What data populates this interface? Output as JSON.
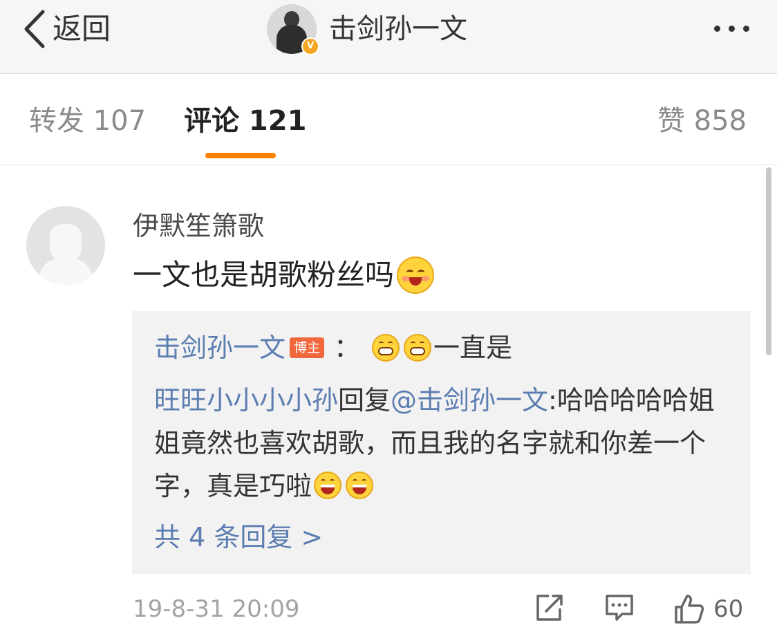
{
  "nav": {
    "back_label": "返回",
    "title": "击剑孙一文",
    "verified_badge": "V"
  },
  "tabs": {
    "repost": "转发 107",
    "comments": "评论 121",
    "likes": "赞 858"
  },
  "comment": {
    "user": "伊默笙箫歌",
    "text": "一文也是胡歌粉丝吗",
    "replies": {
      "first": {
        "author": "击剑孙一文",
        "author_badge": "博主",
        "separator": "：",
        "text": "一直是"
      },
      "second": {
        "author": "旺旺小小小小孙",
        "reply_word": "回复",
        "mention": "@击剑孙一文",
        "text": ":哈哈哈哈哈姐姐竟然也喜欢胡歌，而且我的名字就和你差一个字，真是巧啦"
      },
      "more": "共 4 条回复 >"
    },
    "timestamp": "19-8-31 20:09",
    "likes": "60"
  },
  "icons": {
    "back": "chevron-left-icon",
    "more": "more-dots-icon",
    "share": "share-icon",
    "reply": "comment-icon",
    "like": "thumbs-up-icon"
  },
  "colors": {
    "accent": "#ff8200",
    "link": "#5b7db1",
    "badge": "#f0683b"
  }
}
